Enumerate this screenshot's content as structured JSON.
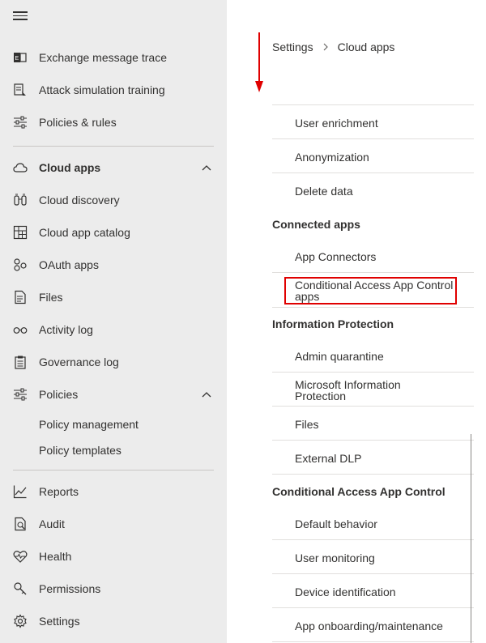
{
  "sidebar": {
    "items": [
      {
        "label": "Exchange message trace",
        "icon": "exchange-icon"
      },
      {
        "label": "Attack simulation training",
        "icon": "attack-sim-icon"
      },
      {
        "label": "Policies & rules",
        "icon": "sliders-icon"
      },
      {
        "label": "Cloud apps",
        "icon": "cloud-icon"
      },
      {
        "label": "Cloud discovery",
        "icon": "binoculars-icon"
      },
      {
        "label": "Cloud app catalog",
        "icon": "catalog-icon"
      },
      {
        "label": "OAuth apps",
        "icon": "oauth-icon"
      },
      {
        "label": "Files",
        "icon": "file-icon"
      },
      {
        "label": "Activity log",
        "icon": "glasses-icon"
      },
      {
        "label": "Governance log",
        "icon": "clipboard-icon"
      },
      {
        "label": "Policies",
        "icon": "sliders-icon"
      },
      {
        "label": "Reports",
        "icon": "chart-icon"
      },
      {
        "label": "Audit",
        "icon": "audit-icon"
      },
      {
        "label": "Health",
        "icon": "heart-icon"
      },
      {
        "label": "Permissions",
        "icon": "key-icon"
      },
      {
        "label": "Settings",
        "icon": "gear-icon"
      }
    ],
    "policies_sub": [
      "Policy management",
      "Policy templates"
    ]
  },
  "breadcrumb": {
    "root": "Settings",
    "current": "Cloud apps"
  },
  "settings": {
    "user_enrichment": "User enrichment",
    "anonymization": "Anonymization",
    "delete_data": "Delete data",
    "connected_apps": "Connected apps",
    "app_connectors": "App Connectors",
    "ca_app_control_apps": "Conditional Access App Control apps",
    "information_protection": "Information Protection",
    "admin_quarantine": "Admin quarantine",
    "mip": "Microsoft Information Protection",
    "files": "Files",
    "external_dlp": "External DLP",
    "ca_app_control": "Conditional Access App Control",
    "default_behavior": "Default behavior",
    "user_monitoring": "User monitoring",
    "device_identification": "Device identification",
    "app_onboarding": "App onboarding/maintenance"
  },
  "colors": {
    "highlight": "#e00000",
    "sidebar_bg": "#ececec"
  }
}
